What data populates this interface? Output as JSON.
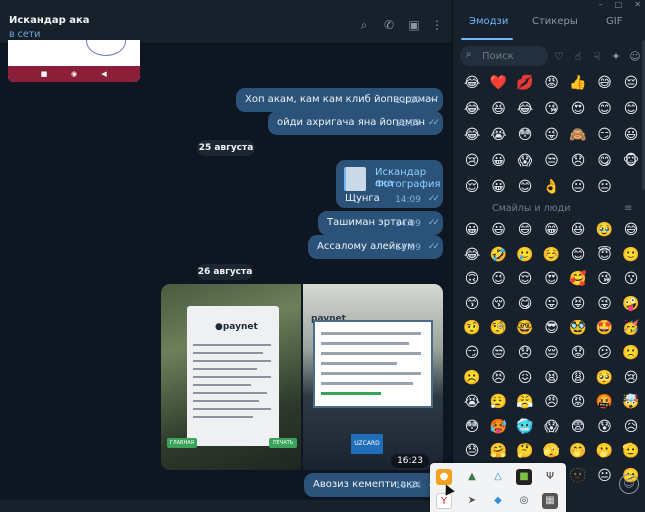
{
  "header": {
    "contact_name": "Искандар ака",
    "status": "в сети",
    "icons": [
      "search-icon",
      "phone-icon",
      "sidebar-icon",
      "more-icon"
    ]
  },
  "messages": {
    "m1": {
      "text": "Хоп акам, кам кам клиб йопвораман",
      "time": "11:07"
    },
    "m2": {
      "text": "ойди ахригача яна йопаман",
      "time": "11:07"
    },
    "date1": "25 августа",
    "fwd": {
      "name": "Искандар ака",
      "type": "Фотография",
      "text": "Щунга",
      "time": "14:09"
    },
    "m3": {
      "text": "Ташиман эртага",
      "time": "14:09"
    },
    "m4": {
      "text": "Ассалому алейкум",
      "time": "14:09"
    },
    "date2": "26 августа",
    "photo_time": "16:23",
    "photo_left": {
      "brand": "●paynet",
      "btn1": "ГЛАВНАЯ",
      "btn2": "ПЕЧАТЬ"
    },
    "photo_right": {
      "brand": "paynet",
      "card": "UZCARD"
    },
    "m5": {
      "text": "Авозиз кемепти ака",
      "time": "16:24"
    }
  },
  "panel": {
    "tabs": [
      "Эмодзи",
      "Стикеры",
      "GIF"
    ],
    "search_placeholder": "Поиск",
    "section_title": "Смайлы и люди",
    "recent": [
      "😂",
      "❤️",
      "💋",
      "😡",
      "👍",
      "😅",
      "😔",
      "😂",
      "😆",
      "😂",
      "😘",
      "😍",
      "😊",
      "😊",
      "😂",
      "😭",
      "😳",
      "😜",
      "🙈",
      "😏",
      "😃",
      "😢",
      "😀",
      "😱",
      "😒",
      "😞",
      "😋",
      "🐵",
      "😌",
      "😀",
      "😊",
      "👌",
      "😐",
      "😐"
    ],
    "smileys": [
      "😀",
      "😃",
      "😄",
      "😁",
      "😆",
      "🥹",
      "😅",
      "😂",
      "🤣",
      "🥲",
      "☺️",
      "😊",
      "😇",
      "🙂",
      "🙃",
      "😉",
      "😌",
      "😍",
      "🥰",
      "😘",
      "😗",
      "😙",
      "😚",
      "😋",
      "😛",
      "😝",
      "😜",
      "🤪",
      "🤨",
      "🧐",
      "🤓",
      "😎",
      "🥸",
      "🤩",
      "🥳",
      "😏",
      "😒",
      "😞",
      "😔",
      "😟",
      "😕",
      "🙁",
      "☹️",
      "😣",
      "😖",
      "😫",
      "😩",
      "🥺",
      "😢",
      "😭",
      "😮‍💨",
      "😤",
      "😠",
      "😡",
      "🤬",
      "🤯",
      "😳",
      "🥵",
      "🥶",
      "😱",
      "😨",
      "😰",
      "😥",
      "😓",
      "🤗",
      "🤔",
      "🫣",
      "🤭",
      "🫢",
      "🫡",
      "🤫",
      "🫠",
      "🤥",
      "😶",
      "🫥",
      "😐",
      "🫤"
    ]
  },
  "colors": {
    "bubble": "#2b5278",
    "panel": "#17212b",
    "background": "#0e1621",
    "accent": "#6fb6ff"
  }
}
